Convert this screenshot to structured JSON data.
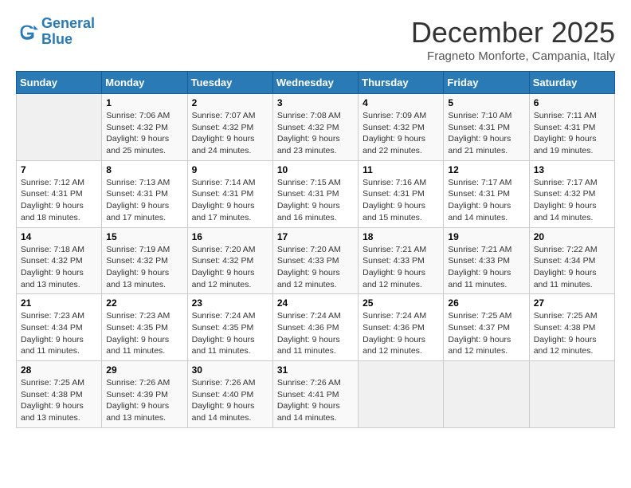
{
  "logo": {
    "line1": "General",
    "line2": "Blue"
  },
  "title": "December 2025",
  "subtitle": "Fragneto Monforte, Campania, Italy",
  "days_of_week": [
    "Sunday",
    "Monday",
    "Tuesday",
    "Wednesday",
    "Thursday",
    "Friday",
    "Saturday"
  ],
  "weeks": [
    [
      {
        "day": "",
        "sunrise": "",
        "sunset": "",
        "daylight": ""
      },
      {
        "day": "1",
        "sunrise": "Sunrise: 7:06 AM",
        "sunset": "Sunset: 4:32 PM",
        "daylight": "Daylight: 9 hours and 25 minutes."
      },
      {
        "day": "2",
        "sunrise": "Sunrise: 7:07 AM",
        "sunset": "Sunset: 4:32 PM",
        "daylight": "Daylight: 9 hours and 24 minutes."
      },
      {
        "day": "3",
        "sunrise": "Sunrise: 7:08 AM",
        "sunset": "Sunset: 4:32 PM",
        "daylight": "Daylight: 9 hours and 23 minutes."
      },
      {
        "day": "4",
        "sunrise": "Sunrise: 7:09 AM",
        "sunset": "Sunset: 4:32 PM",
        "daylight": "Daylight: 9 hours and 22 minutes."
      },
      {
        "day": "5",
        "sunrise": "Sunrise: 7:10 AM",
        "sunset": "Sunset: 4:31 PM",
        "daylight": "Daylight: 9 hours and 21 minutes."
      },
      {
        "day": "6",
        "sunrise": "Sunrise: 7:11 AM",
        "sunset": "Sunset: 4:31 PM",
        "daylight": "Daylight: 9 hours and 19 minutes."
      }
    ],
    [
      {
        "day": "7",
        "sunrise": "Sunrise: 7:12 AM",
        "sunset": "Sunset: 4:31 PM",
        "daylight": "Daylight: 9 hours and 18 minutes."
      },
      {
        "day": "8",
        "sunrise": "Sunrise: 7:13 AM",
        "sunset": "Sunset: 4:31 PM",
        "daylight": "Daylight: 9 hours and 17 minutes."
      },
      {
        "day": "9",
        "sunrise": "Sunrise: 7:14 AM",
        "sunset": "Sunset: 4:31 PM",
        "daylight": "Daylight: 9 hours and 17 minutes."
      },
      {
        "day": "10",
        "sunrise": "Sunrise: 7:15 AM",
        "sunset": "Sunset: 4:31 PM",
        "daylight": "Daylight: 9 hours and 16 minutes."
      },
      {
        "day": "11",
        "sunrise": "Sunrise: 7:16 AM",
        "sunset": "Sunset: 4:31 PM",
        "daylight": "Daylight: 9 hours and 15 minutes."
      },
      {
        "day": "12",
        "sunrise": "Sunrise: 7:17 AM",
        "sunset": "Sunset: 4:31 PM",
        "daylight": "Daylight: 9 hours and 14 minutes."
      },
      {
        "day": "13",
        "sunrise": "Sunrise: 7:17 AM",
        "sunset": "Sunset: 4:32 PM",
        "daylight": "Daylight: 9 hours and 14 minutes."
      }
    ],
    [
      {
        "day": "14",
        "sunrise": "Sunrise: 7:18 AM",
        "sunset": "Sunset: 4:32 PM",
        "daylight": "Daylight: 9 hours and 13 minutes."
      },
      {
        "day": "15",
        "sunrise": "Sunrise: 7:19 AM",
        "sunset": "Sunset: 4:32 PM",
        "daylight": "Daylight: 9 hours and 13 minutes."
      },
      {
        "day": "16",
        "sunrise": "Sunrise: 7:20 AM",
        "sunset": "Sunset: 4:32 PM",
        "daylight": "Daylight: 9 hours and 12 minutes."
      },
      {
        "day": "17",
        "sunrise": "Sunrise: 7:20 AM",
        "sunset": "Sunset: 4:33 PM",
        "daylight": "Daylight: 9 hours and 12 minutes."
      },
      {
        "day": "18",
        "sunrise": "Sunrise: 7:21 AM",
        "sunset": "Sunset: 4:33 PM",
        "daylight": "Daylight: 9 hours and 12 minutes."
      },
      {
        "day": "19",
        "sunrise": "Sunrise: 7:21 AM",
        "sunset": "Sunset: 4:33 PM",
        "daylight": "Daylight: 9 hours and 11 minutes."
      },
      {
        "day": "20",
        "sunrise": "Sunrise: 7:22 AM",
        "sunset": "Sunset: 4:34 PM",
        "daylight": "Daylight: 9 hours and 11 minutes."
      }
    ],
    [
      {
        "day": "21",
        "sunrise": "Sunrise: 7:23 AM",
        "sunset": "Sunset: 4:34 PM",
        "daylight": "Daylight: 9 hours and 11 minutes."
      },
      {
        "day": "22",
        "sunrise": "Sunrise: 7:23 AM",
        "sunset": "Sunset: 4:35 PM",
        "daylight": "Daylight: 9 hours and 11 minutes."
      },
      {
        "day": "23",
        "sunrise": "Sunrise: 7:24 AM",
        "sunset": "Sunset: 4:35 PM",
        "daylight": "Daylight: 9 hours and 11 minutes."
      },
      {
        "day": "24",
        "sunrise": "Sunrise: 7:24 AM",
        "sunset": "Sunset: 4:36 PM",
        "daylight": "Daylight: 9 hours and 11 minutes."
      },
      {
        "day": "25",
        "sunrise": "Sunrise: 7:24 AM",
        "sunset": "Sunset: 4:36 PM",
        "daylight": "Daylight: 9 hours and 12 minutes."
      },
      {
        "day": "26",
        "sunrise": "Sunrise: 7:25 AM",
        "sunset": "Sunset: 4:37 PM",
        "daylight": "Daylight: 9 hours and 12 minutes."
      },
      {
        "day": "27",
        "sunrise": "Sunrise: 7:25 AM",
        "sunset": "Sunset: 4:38 PM",
        "daylight": "Daylight: 9 hours and 12 minutes."
      }
    ],
    [
      {
        "day": "28",
        "sunrise": "Sunrise: 7:25 AM",
        "sunset": "Sunset: 4:38 PM",
        "daylight": "Daylight: 9 hours and 13 minutes."
      },
      {
        "day": "29",
        "sunrise": "Sunrise: 7:26 AM",
        "sunset": "Sunset: 4:39 PM",
        "daylight": "Daylight: 9 hours and 13 minutes."
      },
      {
        "day": "30",
        "sunrise": "Sunrise: 7:26 AM",
        "sunset": "Sunset: 4:40 PM",
        "daylight": "Daylight: 9 hours and 14 minutes."
      },
      {
        "day": "31",
        "sunrise": "Sunrise: 7:26 AM",
        "sunset": "Sunset: 4:41 PM",
        "daylight": "Daylight: 9 hours and 14 minutes."
      },
      {
        "day": "",
        "sunrise": "",
        "sunset": "",
        "daylight": ""
      },
      {
        "day": "",
        "sunrise": "",
        "sunset": "",
        "daylight": ""
      },
      {
        "day": "",
        "sunrise": "",
        "sunset": "",
        "daylight": ""
      }
    ]
  ]
}
